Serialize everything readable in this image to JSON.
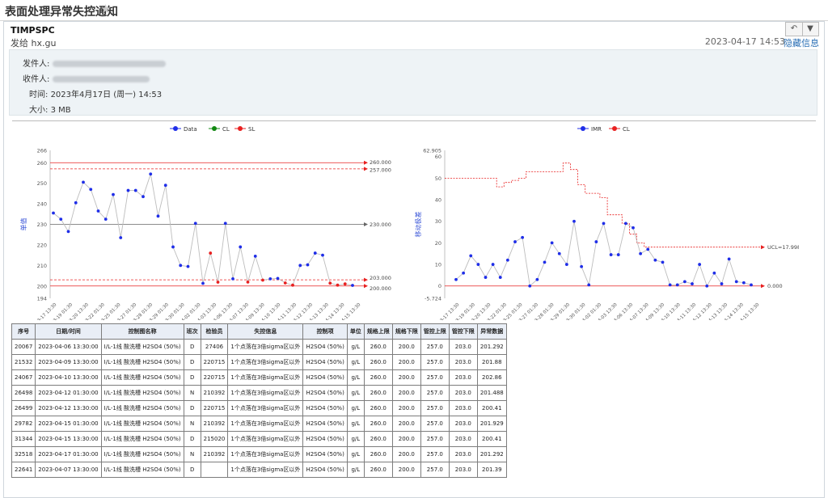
{
  "window": {
    "subject": "表面处理异常失控通知",
    "star_icon": "star-icon"
  },
  "mail": {
    "sender": "TIMPSPC",
    "to_line": "发给 hx.gu",
    "date": "2023-04-17 14:53",
    "hide_info_label": "隐藏信息",
    "info": {
      "from_label": "发件人:",
      "to_label": "收件人:",
      "time_label": "时间:",
      "time_value": "2023年4月17日 (周一) 14:53",
      "size_label": "大小:",
      "size_value": "3 MB"
    }
  },
  "chart_data": [
    {
      "type": "line",
      "legend": [
        "Data",
        "CL",
        "SL"
      ],
      "ylabel": "单值",
      "ylim": [
        194,
        266
      ],
      "yticks": [
        194,
        200,
        210,
        220,
        230,
        240,
        250,
        260,
        266
      ],
      "limit_labels": [
        "260.000",
        "257.000",
        "230.000",
        "203.000",
        "200.000"
      ],
      "limits": {
        "USL": 260,
        "UCL": 257,
        "CL": 230,
        "LCL": 203,
        "LSL": 200
      },
      "xticks": [
        "2023-03-17 13:30",
        "2023-03-19 01:30",
        "2023-03-20 13:30",
        "2023-03-22 01:30",
        "2023-03-25 01:30",
        "2023-03-27 01:30",
        "2023-03-28 01:30",
        "2023-03-29 01:30",
        "2023-03-30 01:30",
        "2023-04-02 01:30",
        "2023-04-03 13:30",
        "2023-04-06 13:30",
        "2023-04-07 13:30",
        "2023-04-09 13:30",
        "2023-04-10 13:30",
        "2023-04-11 13:30",
        "2023-04-12 13:30",
        "2023-04-13 13:30",
        "2023-04-14 13:30",
        "2023-04-15 13:30"
      ],
      "series": [
        {
          "name": "Data",
          "color": "#1f2ee8",
          "values": [
            235.5,
            232.5,
            226.5,
            240.5,
            250.5,
            247.0,
            236.5,
            232.5,
            244.5,
            223.5,
            246.5,
            246.5,
            243.5,
            254.5,
            234.0,
            249.0,
            219.0,
            210.0,
            209.5,
            230.5,
            201.292,
            216.0,
            201.88,
            230.5,
            203.5,
            219.0,
            201.929,
            214.5,
            202.86,
            203.5,
            203.7,
            201.488,
            200.41,
            210.0,
            210.3,
            216.0,
            215.0,
            201.39,
            200.41,
            201.0,
            200.3
          ]
        }
      ],
      "red_point_indices": [
        21,
        22,
        26,
        28,
        31,
        32,
        37,
        38,
        39
      ]
    },
    {
      "type": "line",
      "legend": [
        "IMR",
        "CL"
      ],
      "ylabel": "移动极差",
      "ylim": [
        -5.724,
        62.905
      ],
      "yticks": [
        "62.905",
        "60",
        "50",
        "40",
        "30",
        "20",
        "10",
        "0",
        "-5.724"
      ],
      "limit_labels": [
        "UCL=17.998",
        "0.000"
      ],
      "ucl_final": 17.998,
      "cl": 0,
      "xticks": [
        "2023-03-17 13:30",
        "2023-03-19 01:30",
        "2023-03-20 13:30",
        "2023-03-22 01:30",
        "2023-03-25 01:30",
        "2023-03-27 01:30",
        "2023-03-28 01:30",
        "2023-03-29 01:30",
        "2023-03-30 01:30",
        "2023-04-02 01:30",
        "2023-04-03 13:30",
        "2023-04-06 13:30",
        "2023-04-07 13:30",
        "2023-04-09 13:30",
        "2023-04-10 13:30",
        "2023-04-11 13:30",
        "2023-04-12 13:30",
        "2023-04-13 13:30",
        "2023-04-14 13:30",
        "2023-04-15 13:30"
      ],
      "series": [
        {
          "name": "IMR",
          "color": "#1f2ee8",
          "values": [
            3.0,
            6.0,
            14.0,
            10.0,
            4.0,
            10.0,
            4.0,
            12.0,
            20.5,
            22.5,
            0.0,
            3.0,
            11.0,
            20.0,
            15.0,
            10.0,
            30.0,
            9.0,
            0.5,
            20.5,
            29.0,
            14.5,
            14.5,
            29.0,
            27.0,
            15.0,
            17.0,
            12.0,
            11.0,
            0.5,
            0.5,
            2.0,
            1.0,
            10.0,
            0.0,
            6.0,
            1.0,
            12.5,
            2.0,
            1.5,
            0.5
          ]
        },
        {
          "name": "UCL",
          "color": "#e82020",
          "values": [
            50,
            50,
            50,
            50,
            50,
            50,
            46,
            48,
            49,
            50,
            53,
            53,
            53,
            53,
            53,
            57,
            54,
            47,
            43,
            43,
            41,
            33,
            33,
            29,
            24,
            20,
            18,
            18,
            18,
            18,
            18,
            18,
            18,
            18,
            18,
            18,
            18,
            18,
            18,
            18,
            18
          ]
        }
      ]
    }
  ],
  "table": {
    "headers": [
      "序号",
      "日期/时间",
      "控制图名称",
      "班次",
      "检验员",
      "失控信息",
      "控制项",
      "单位",
      "规格上限",
      "规格下限",
      "管控上限",
      "管控下限",
      "异常数据"
    ],
    "rows": [
      [
        "20067",
        "2023-04-06 13:30:00",
        "I/L-1线 酸洗槽 H2SO4 (50%)",
        "D",
        "27406",
        "1个点落在3倍sigma区以外",
        "H2SO4 (50%)",
        "g/L",
        "260.0",
        "200.0",
        "257.0",
        "203.0",
        "201.292"
      ],
      [
        "21532",
        "2023-04-09 13:30:00",
        "I/L-1线 酸洗槽 H2SO4 (50%)",
        "D",
        "220715",
        "1个点落在3倍sigma区以外",
        "H2SO4 (50%)",
        "g/L",
        "260.0",
        "200.0",
        "257.0",
        "203.0",
        "201.88"
      ],
      [
        "24067",
        "2023-04-10 13:30:00",
        "I/L-1线 酸洗槽 H2SO4 (50%)",
        "D",
        "220715",
        "1个点落在3倍sigma区以外",
        "H2SO4 (50%)",
        "g/L",
        "260.0",
        "200.0",
        "257.0",
        "203.0",
        "202.86"
      ],
      [
        "26498",
        "2023-04-12 01:30:00",
        "I/L-1线 酸洗槽 H2SO4 (50%)",
        "N",
        "210392",
        "1个点落在3倍sigma区以外",
        "H2SO4 (50%)",
        "g/L",
        "260.0",
        "200.0",
        "257.0",
        "203.0",
        "201.488"
      ],
      [
        "26499",
        "2023-04-12 13:30:00",
        "I/L-1线 酸洗槽 H2SO4 (50%)",
        "D",
        "220715",
        "1个点落在3倍sigma区以外",
        "H2SO4 (50%)",
        "g/L",
        "260.0",
        "200.0",
        "257.0",
        "203.0",
        "200.41"
      ],
      [
        "29782",
        "2023-04-15 01:30:00",
        "I/L-1线 酸洗槽 H2SO4 (50%)",
        "N",
        "210392",
        "1个点落在3倍sigma区以外",
        "H2SO4 (50%)",
        "g/L",
        "260.0",
        "200.0",
        "257.0",
        "203.0",
        "201.929"
      ],
      [
        "31344",
        "2023-04-15 13:30:00",
        "I/L-1线 酸洗槽 H2SO4 (50%)",
        "D",
        "215020",
        "1个点落在3倍sigma区以外",
        "H2SO4 (50%)",
        "g/L",
        "260.0",
        "200.0",
        "257.0",
        "203.0",
        "200.41"
      ],
      [
        "32518",
        "2023-04-17 01:30:00",
        "I/L-1线 酸洗槽 H2SO4 (50%)",
        "N",
        "210392",
        "1个点落在3倍sigma区以外",
        "H2SO4 (50%)",
        "g/L",
        "260.0",
        "200.0",
        "257.0",
        "203.0",
        "201.292"
      ],
      [
        "22641",
        "2023-04-07 13:30:00",
        "I/L-1线 酸洗槽 H2SO4 (50%)",
        "D",
        "",
        "1个点落在3倍sigma区以外",
        "H2SO4 (50%)",
        "g/L",
        "260.0",
        "200.0",
        "257.0",
        "203.0",
        "201.39"
      ]
    ]
  }
}
